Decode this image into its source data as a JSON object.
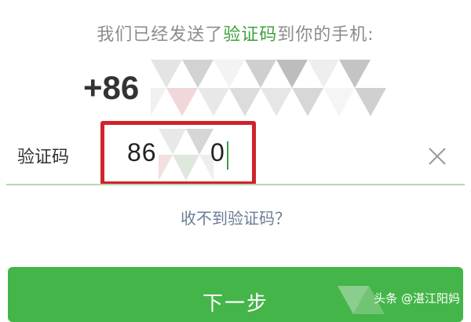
{
  "header": {
    "notice_text": "我们已经发送了",
    "notice_highlight": "验证码",
    "notice_suffix": "到你的手机:"
  },
  "phone": {
    "country_prefix": "+86"
  },
  "verification": {
    "label": "验证码",
    "value_visible_start": "86",
    "value_visible_end": "0"
  },
  "links": {
    "resend": "收不到验证码？"
  },
  "actions": {
    "next_label": "下一步"
  },
  "watermark": {
    "text": "头条 @湛江阳妈"
  },
  "colors": {
    "accent_green": "#44b549",
    "highlight_border": "#d0232a",
    "link_blue": "#6a7d96"
  }
}
